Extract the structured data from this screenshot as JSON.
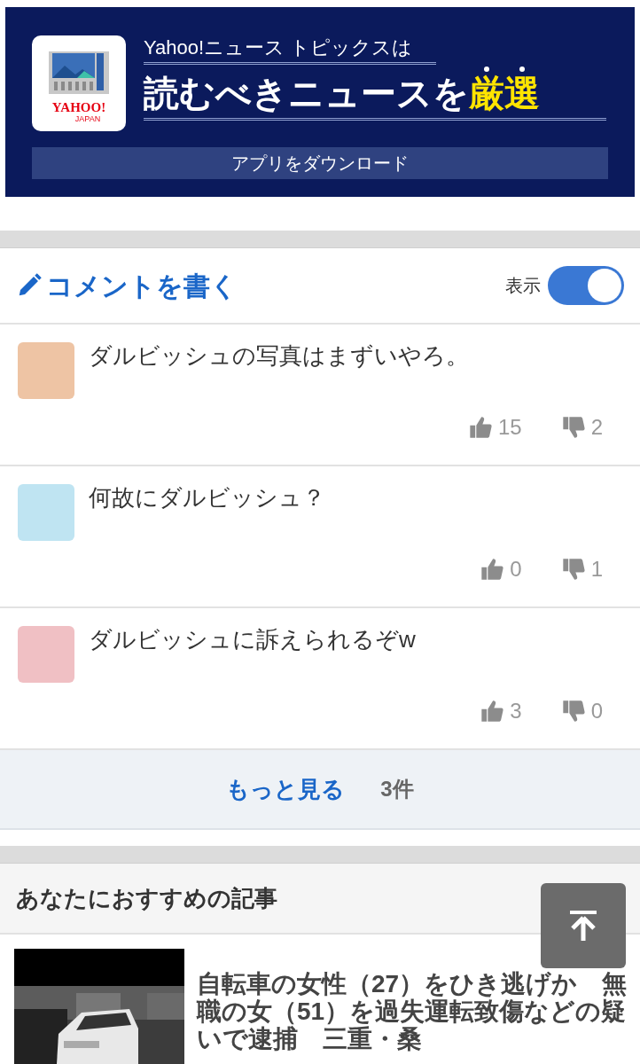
{
  "banner": {
    "logo_text": "YAHOO!",
    "logo_subtext": "JAPAN",
    "tagline": "Yahoo!ニュース トピックスは",
    "headline": "読むべきニュースを",
    "headline_highlight": "厳選",
    "button": "アプリをダウンロード"
  },
  "comment_header": {
    "write_label": "コメントを書く",
    "display_label": "表示",
    "display_on": true
  },
  "comments": [
    {
      "text": "ダルビッシュの写真はまずいやろ。",
      "color": "#eec4a4",
      "likes": "15",
      "dislikes": "2"
    },
    {
      "text": "何故にダルビッシュ？",
      "color": "#bfe4f2",
      "likes": "0",
      "dislikes": "1"
    },
    {
      "text": "ダルビッシュに訴えられるぞw",
      "color": "#f0c0c4",
      "likes": "3",
      "dislikes": "0"
    }
  ],
  "more": {
    "label": "もっと見る",
    "count": "3件"
  },
  "recommended": {
    "title": "あなたにおすすめの記事",
    "articles": [
      {
        "kind": "picture",
        "title": "自転車の女性（27）をひき逃げか　無職の女（51）を過失運転致傷などの疑いで逮捕　三重・桑"
      }
    ]
  }
}
